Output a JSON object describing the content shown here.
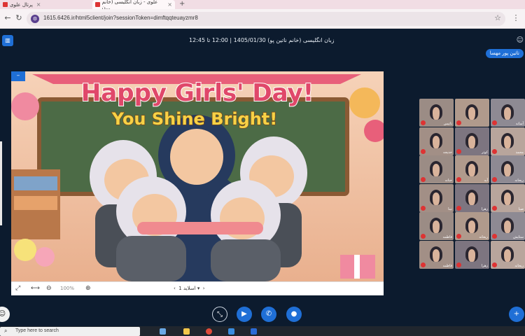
{
  "browser": {
    "tabs": [
      {
        "title": "پرتال علوی",
        "active": false
      },
      {
        "title": "علوی - زبان انگلیسی (خانم ن...",
        "active": true
      }
    ],
    "url": "1615.6426.ir/html5client/join?sessionToken=dimftqqteuayzmr8"
  },
  "meeting": {
    "title": "زبان انگلیسی (خانم ناتین پو) 1405/01/30 | 12:00 تا 12:45",
    "presenter": "تاتین پور مهسا"
  },
  "slide": {
    "heading": "Happy Girls' Day!",
    "subheading": "You Shine Bright!",
    "zoom": "100%",
    "slide_label": "اسلاید 1"
  },
  "participants": [
    {
      "name": "ناتیس"
    },
    {
      "name": ""
    },
    {
      "name": "آسانه"
    },
    {
      "name": "خدیجه"
    },
    {
      "name": "کوثر"
    },
    {
      "name": "محمد"
    },
    {
      "name": "حنانه"
    },
    {
      "name": "آیه"
    },
    {
      "name": "ریحانه"
    },
    {
      "name": "تینا"
    },
    {
      "name": "زهرا"
    },
    {
      "name": "صبا"
    },
    {
      "name": "فاطمه"
    },
    {
      "name": "ریحانه"
    },
    {
      "name": "ستایش"
    },
    {
      "name": "فاطمه"
    },
    {
      "name": "زهرا"
    },
    {
      "name": "ریحانه"
    }
  ],
  "taskbar": {
    "search_placeholder": "Type here to search"
  },
  "colors": {
    "accent": "#1f6fd6",
    "background": "#0c1b2e"
  }
}
